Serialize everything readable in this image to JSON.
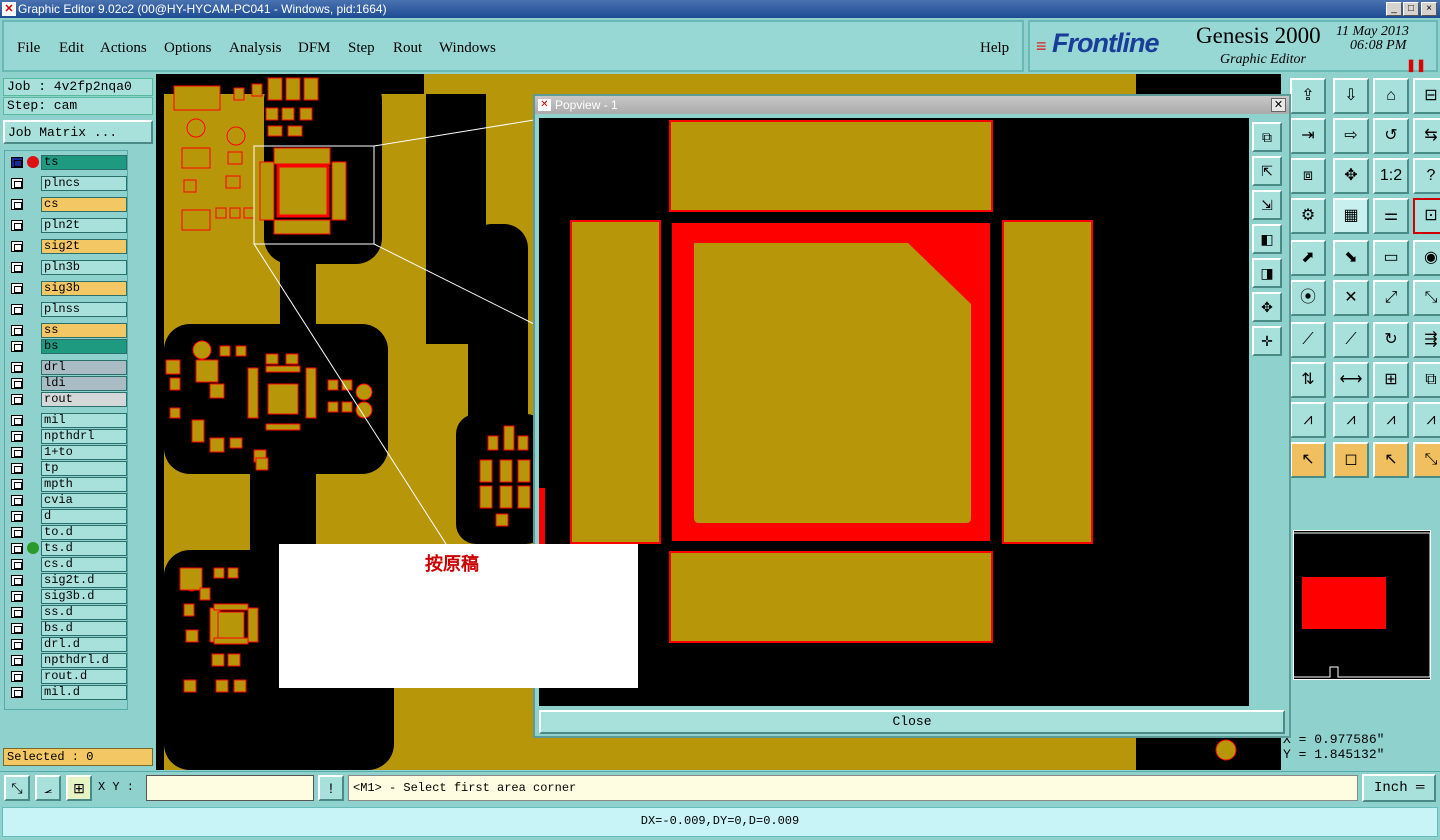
{
  "window": {
    "title": "Graphic Editor 9.02c2 (00@HY-HYCAM-PC041 - Windows, pid:1664)",
    "buttons": [
      "_",
      "□",
      "×"
    ]
  },
  "menu": {
    "items": [
      "File",
      "Edit",
      "Actions",
      "Options",
      "Analysis",
      "DFM",
      "Step",
      "Rout",
      "Windows"
    ],
    "help": "Help"
  },
  "brand": {
    "logo": "Frontline",
    "product": "Genesis 2000",
    "subtitle": "Graphic Editor",
    "date": "11 May 2013",
    "time": "06:08 PM"
  },
  "job": {
    "job_label": "Job : 4v2fp2nqa0",
    "step_label": "Step: cam",
    "matrix_button": "Job Matrix ..."
  },
  "layers": [
    {
      "name": "ts",
      "color": "#1d9a80",
      "active": true
    },
    {
      "name": "plncs",
      "color": "#a8e0dc"
    },
    {
      "name": "cs",
      "color": "#f3c864"
    },
    {
      "name": "pln2t",
      "color": "#a8e0dc"
    },
    {
      "name": "sig2t",
      "color": "#f3c864"
    },
    {
      "name": "pln3b",
      "color": "#a8e0dc"
    },
    {
      "name": "sig3b",
      "color": "#f3c864"
    },
    {
      "name": "plnss",
      "color": "#a8e0dc"
    },
    {
      "name": "ss",
      "color": "#f3c864"
    },
    {
      "name": "bs",
      "color": "#1d9a80"
    },
    {
      "name": "drl",
      "color": "#a9bcc4"
    },
    {
      "name": "ldi",
      "color": "#a9bcc4"
    },
    {
      "name": "rout",
      "color": "#d4d8d8"
    },
    {
      "name": "mil",
      "color": "#a8e0dc"
    },
    {
      "name": "npthdrl",
      "color": "#a8e0dc"
    },
    {
      "name": "1+to",
      "color": "#a8e0dc"
    },
    {
      "name": "tp",
      "color": "#a8e0dc"
    },
    {
      "name": "mpth",
      "color": "#a8e0dc"
    },
    {
      "name": "cvia",
      "color": "#a8e0dc"
    },
    {
      "name": "d",
      "color": "#a8e0dc"
    },
    {
      "name": "to.d",
      "color": "#a8e0dc"
    },
    {
      "name": "ts.d",
      "color": "#a8e0dc"
    },
    {
      "name": "cs.d",
      "color": "#a8e0dc"
    },
    {
      "name": "sig2t.d",
      "color": "#a8e0dc"
    },
    {
      "name": "sig3b.d",
      "color": "#a8e0dc"
    },
    {
      "name": "ss.d",
      "color": "#a8e0dc"
    },
    {
      "name": "bs.d",
      "color": "#a8e0dc"
    },
    {
      "name": "drl.d",
      "color": "#a8e0dc"
    },
    {
      "name": "npthdrl.d",
      "color": "#a8e0dc"
    },
    {
      "name": "rout.d",
      "color": "#a8e0dc"
    },
    {
      "name": "mil.d",
      "color": "#a8e0dc"
    }
  ],
  "selected": "Selected : 0",
  "popview": {
    "title": "Popview - 1",
    "close_label": "Close"
  },
  "annotation": "按原稿",
  "coords": {
    "x": "X = 0.977586\"",
    "y": "Y = 1.845132\""
  },
  "command": {
    "xy_label": "X Y :",
    "xy_value": "",
    "prompt": "<M1> - Select first area corner",
    "unit": "Inch"
  },
  "status": "DX=-0.009,DY=0,D=0.009",
  "colors": {
    "copper": "#b8960a",
    "pad_outline": "#ff0000",
    "board_bg": "#000000",
    "panel_bg": "#8fd1cd"
  }
}
